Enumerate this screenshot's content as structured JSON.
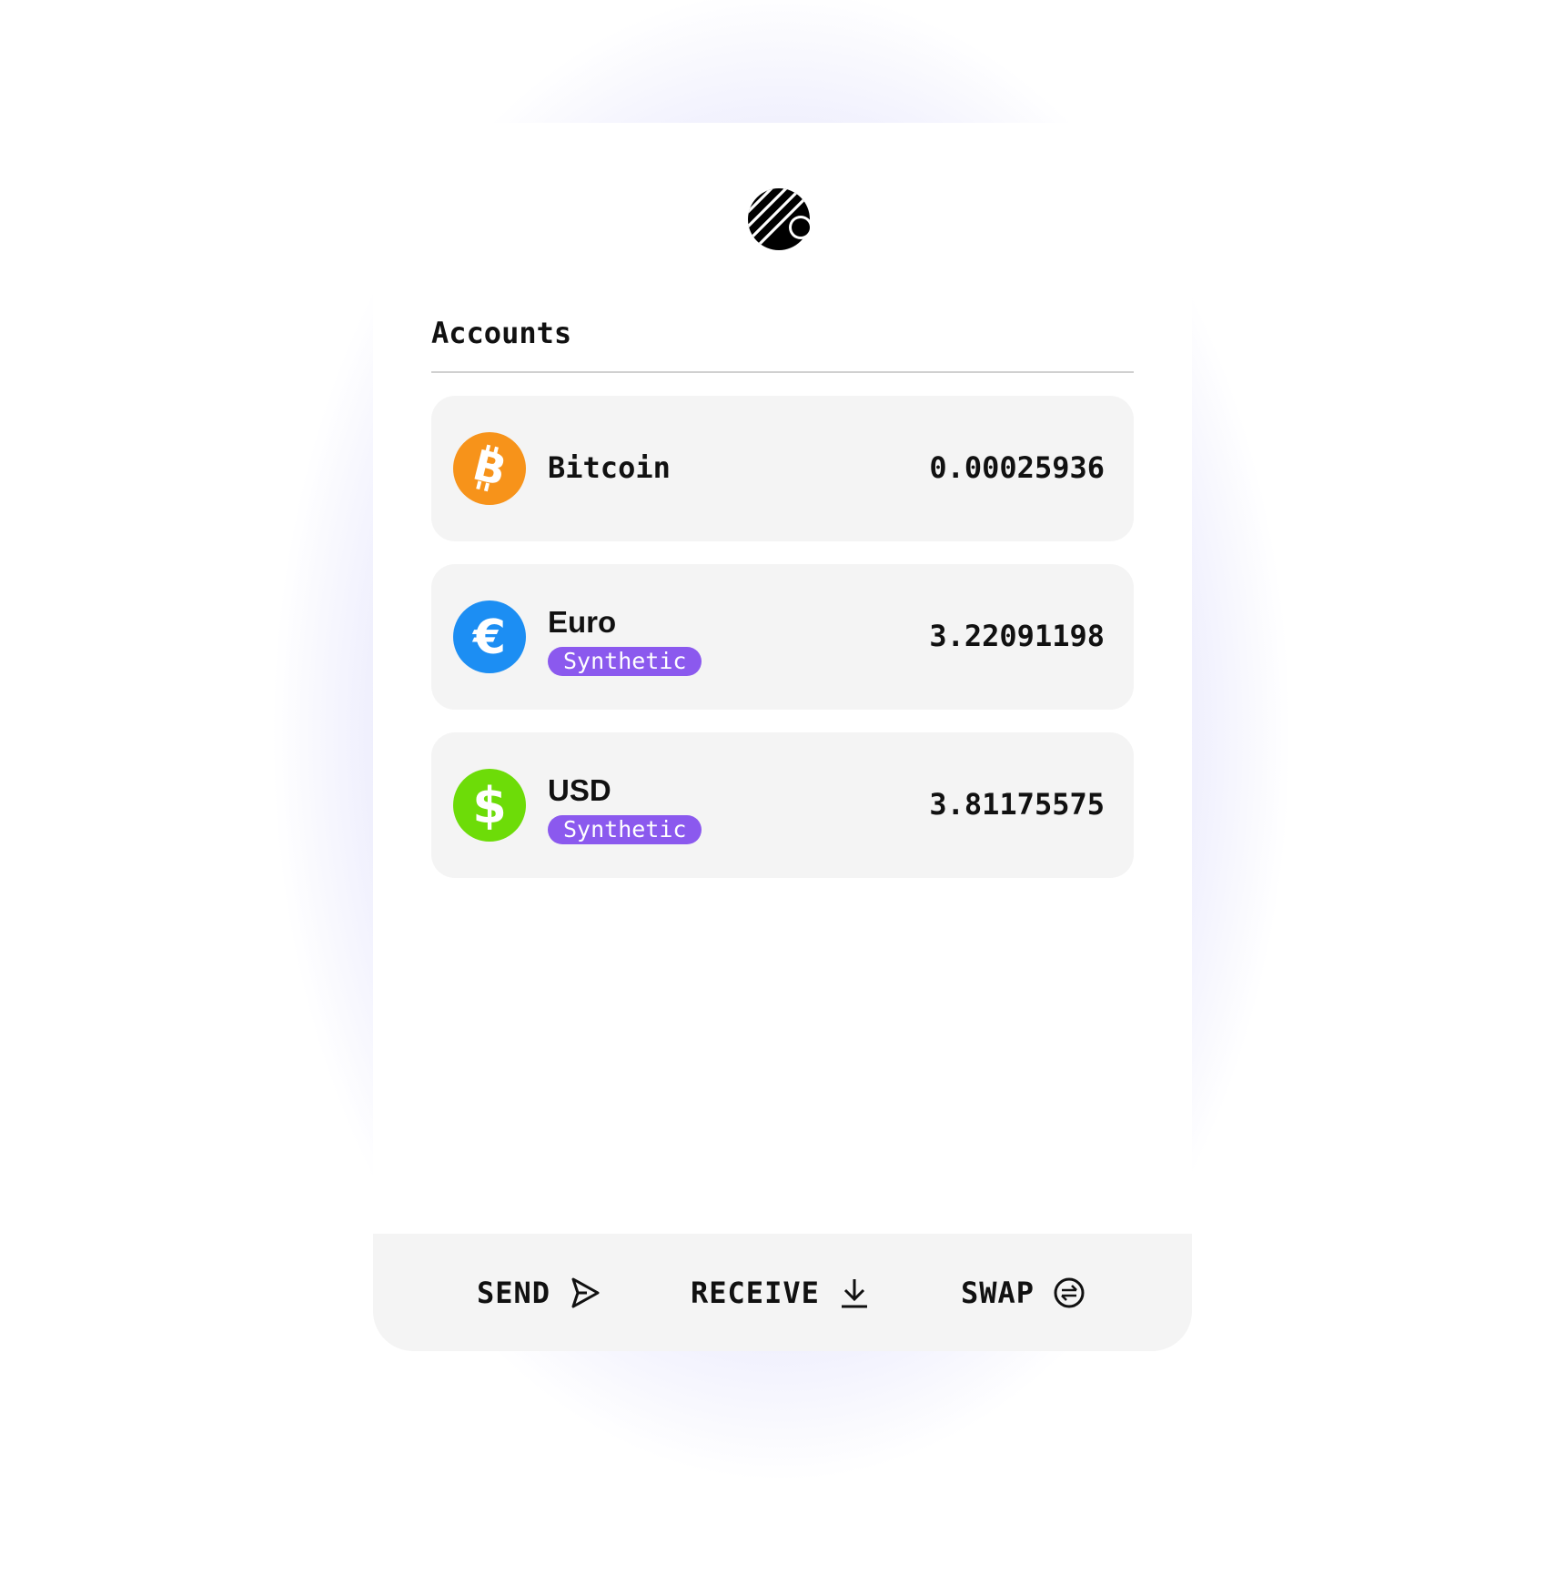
{
  "app": {
    "logo": "stripe-circle-logo"
  },
  "accounts_section": {
    "title": "Accounts",
    "items": [
      {
        "name": "Bitcoin",
        "balance": "0.00025936",
        "icon": "bitcoin-icon",
        "icon_color": "#f7931a",
        "badge": null
      },
      {
        "name": "Euro",
        "balance": "3.22091198",
        "icon": "euro-icon",
        "icon_color": "#1c8ef3",
        "badge": "Synthetic"
      },
      {
        "name": "USD",
        "balance": "3.81175575",
        "icon": "dollar-icon",
        "icon_color": "#6ddc08",
        "badge": "Synthetic"
      }
    ]
  },
  "actions": {
    "send_label": "SEND",
    "receive_label": "RECEIVE",
    "swap_label": "SWAP"
  },
  "colors": {
    "badge": "#8b59ee",
    "row_background": "#f4f4f4",
    "glow": "#b0adf8"
  }
}
